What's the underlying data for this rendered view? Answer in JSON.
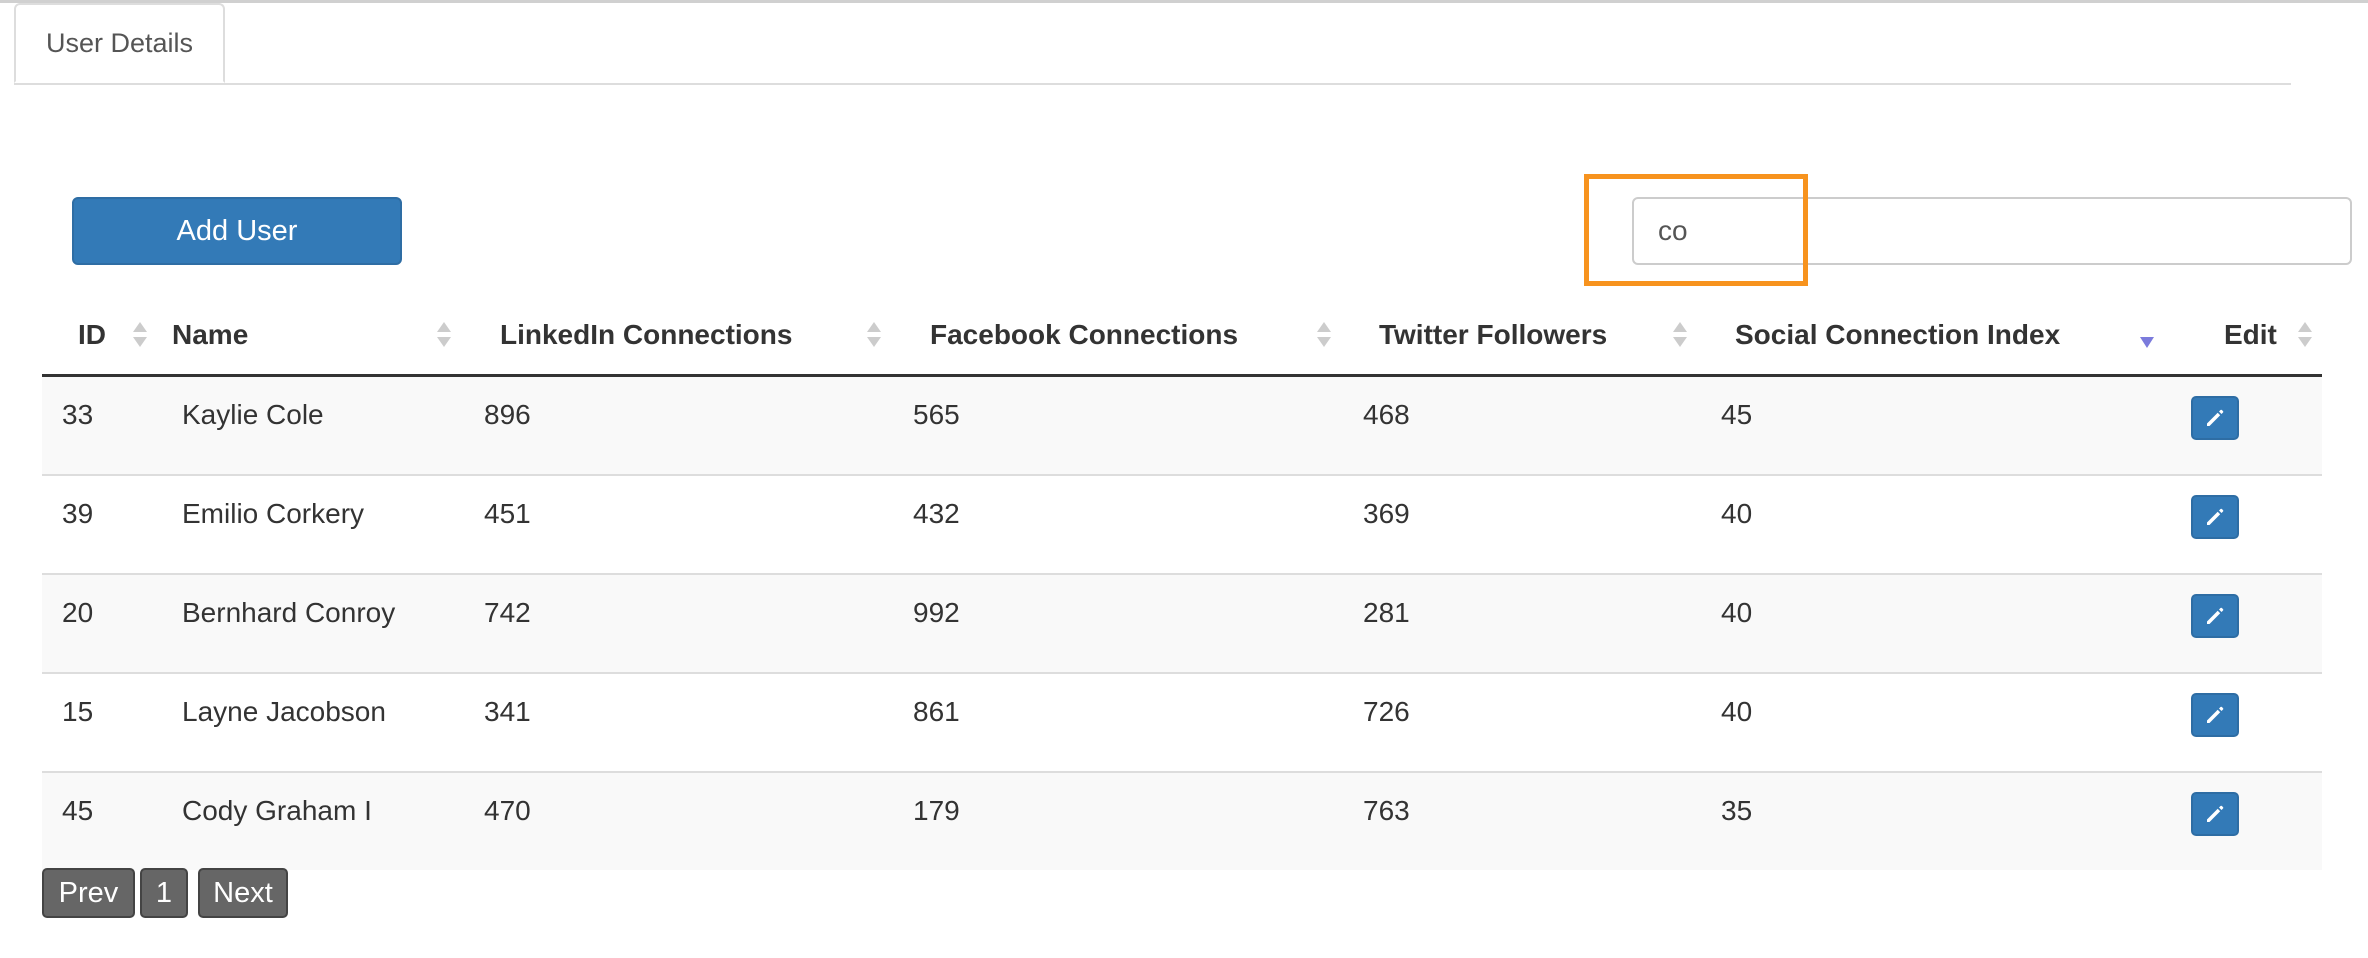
{
  "tabs": [
    {
      "label": "User Details"
    }
  ],
  "toolbar": {
    "add_user_label": "Add User"
  },
  "search": {
    "value": "co",
    "placeholder": ""
  },
  "table": {
    "columns": [
      {
        "label": "ID",
        "sort": "none"
      },
      {
        "label": "Name",
        "sort": "none"
      },
      {
        "label": "LinkedIn Connections",
        "sort": "none"
      },
      {
        "label": "Facebook Connections",
        "sort": "none"
      },
      {
        "label": "Twitter Followers",
        "sort": "none"
      },
      {
        "label": "Social Connection Index",
        "sort": "descending"
      },
      {
        "label": "Edit",
        "sort": "none"
      }
    ],
    "rows": [
      {
        "id": "33",
        "name": "Kaylie Cole",
        "linkedin": "896",
        "facebook": "565",
        "twitter": "468",
        "sci": "45"
      },
      {
        "id": "39",
        "name": "Emilio Corkery",
        "linkedin": "451",
        "facebook": "432",
        "twitter": "369",
        "sci": "40"
      },
      {
        "id": "20",
        "name": "Bernhard Conroy",
        "linkedin": "742",
        "facebook": "992",
        "twitter": "281",
        "sci": "40"
      },
      {
        "id": "15",
        "name": "Layne Jacobson",
        "linkedin": "341",
        "facebook": "861",
        "twitter": "726",
        "sci": "40"
      },
      {
        "id": "45",
        "name": "Cody Graham I",
        "linkedin": "470",
        "facebook": "179",
        "twitter": "763",
        "sci": "35"
      }
    ]
  },
  "pagination": {
    "prev_label": "Prev",
    "page_label": "1",
    "next_label": "Next"
  },
  "colors": {
    "primary": "#337ab7",
    "highlight": "#f7931e",
    "pager": "#666666",
    "active_sort": "#7b7bdc",
    "inactive_sort": "#cccccc"
  },
  "icons": {
    "edit": "pencil-icon",
    "sort": "sort-arrows-icon"
  }
}
